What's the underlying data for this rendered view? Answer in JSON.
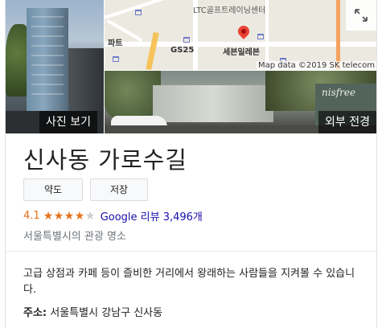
{
  "photos": {
    "photos_caption": "사진 보기",
    "outside_caption": "외부 전경",
    "shop_sign_text": "nisfree"
  },
  "map": {
    "labels": {
      "top_landmark": "LTC골프트레이닝센터",
      "left_cut": "파트",
      "gs25": "GS25",
      "seven": "세븐일레븐"
    },
    "copyright": "Map data ©2019 SK telecom"
  },
  "place": {
    "name": "신사동 가로수길",
    "buttons": {
      "directions": "약도",
      "save": "저장"
    },
    "rating": 4.1,
    "rating_display": "4.1",
    "reviews_text": "Google 리뷰 3,496개",
    "category": "서울특별시의 관광 명소",
    "description": "고급 상점과 카페 등이 즐비한 거리에서 왕래하는 사람들을 지켜볼 수 있습니다.",
    "address_label": "주소:",
    "address_value": " 서울특별시 강남구 신사동"
  },
  "colors": {
    "star": "#e7711b",
    "link": "#1a0dab",
    "pin": "#ea4335"
  },
  "icons": {
    "expand": "expand-icon",
    "pin": "map-pin-icon",
    "shop": "shopping-cart-icon"
  }
}
